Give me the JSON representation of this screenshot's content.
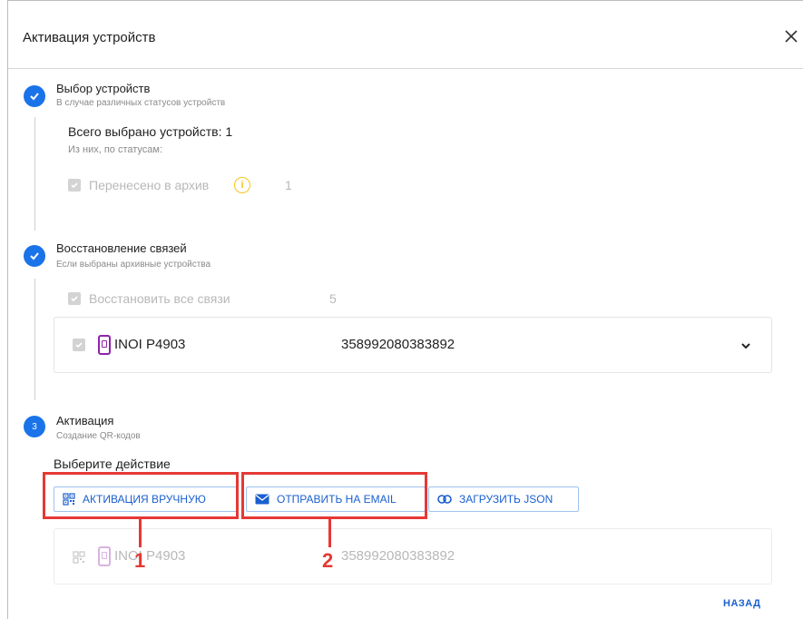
{
  "dialog": {
    "title": "Активация устройств"
  },
  "step1": {
    "title": "Выбор устройств",
    "subtitle": "В случае различных статусов устройств",
    "total": "Всего выбрано устройств: 1",
    "by_status": "Из них, по статусам:",
    "archived_label": "Перенесено в архив",
    "archived_count": "1"
  },
  "step2": {
    "title": "Восстановление связей",
    "subtitle": "Если выбраны архивные устройства",
    "restore_all_label": "Восстановить все связи",
    "restore_all_count": "5",
    "device": {
      "name": "INOI P4903",
      "imei": "358992080383892"
    }
  },
  "step3": {
    "number": "3",
    "title": "Активация",
    "subtitle": "Создание QR-кодов",
    "choose_action": "Выберите действие",
    "buttons": {
      "manual": "АКТИВАЦИЯ ВРУЧНУЮ",
      "email": "ОТПРАВИТЬ НА EMAIL",
      "json": "ЗАГРУЗИТЬ JSON"
    },
    "device": {
      "name": "INOI P4903",
      "imei": "358992080383892"
    }
  },
  "annotations": {
    "one": "1",
    "two": "2"
  },
  "footer": {
    "back": "НАЗАД"
  },
  "colors": {
    "accent": "#1a73e8",
    "annotation": "#e53935",
    "warning": "#f5c518"
  }
}
